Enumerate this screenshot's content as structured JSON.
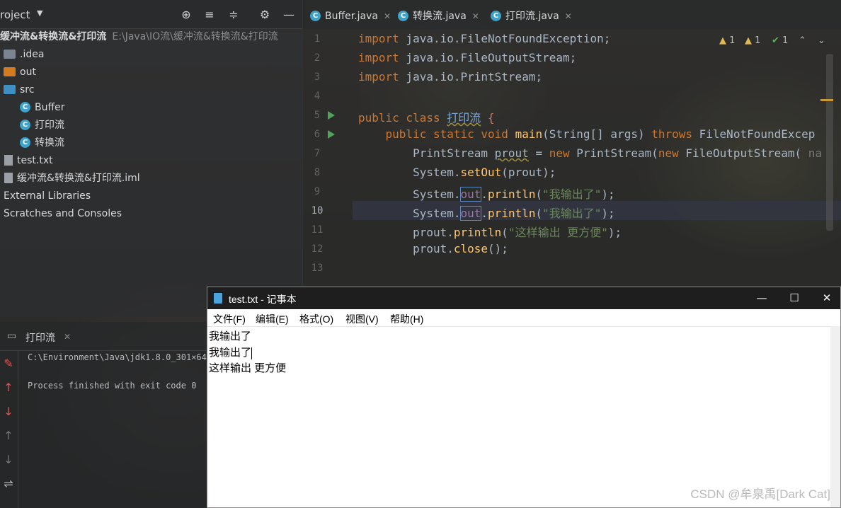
{
  "project_panel": {
    "title": "roject",
    "dropdown": "▼",
    "root": {
      "label": "缓冲流&转换流&打印流",
      "path": "E:\\Java\\IO流\\缓冲流&转换流&打印流"
    },
    "items": [
      {
        "label": ".idea",
        "kind": "folder"
      },
      {
        "label": "out",
        "kind": "folder"
      },
      {
        "label": "src",
        "kind": "folder"
      },
      {
        "label": "Buffer",
        "kind": "class"
      },
      {
        "label": "打印流",
        "kind": "class"
      },
      {
        "label": "转换流",
        "kind": "class"
      },
      {
        "label": "test.txt",
        "kind": "file"
      },
      {
        "label": "缓冲流&转换流&打印流.iml",
        "kind": "file"
      },
      {
        "label": "External Libraries",
        "kind": "node"
      },
      {
        "label": "Scratches and Consoles",
        "kind": "node"
      }
    ],
    "colors": {
      "idea_folder": "#7a8591",
      "out_folder": "#d47a1f",
      "src_folder": "#3d8fc4",
      "class_icon": "#3da3c9"
    }
  },
  "tabs": [
    {
      "label": "Buffer.java",
      "close": "✕"
    },
    {
      "label": "转换流.java",
      "close": "✕"
    },
    {
      "label": "打印流.java",
      "close": "✕"
    }
  ],
  "editor": {
    "line_numbers": [
      "1",
      "2",
      "3",
      "4",
      "5",
      "6",
      "7",
      "8",
      "9",
      "10",
      "11",
      "12",
      "13"
    ],
    "current_line": "10",
    "inspections": {
      "warn1": "1",
      "warn2": "1",
      "ok": "1"
    },
    "code": {
      "l1_kw": "import",
      "l1_rest": " java.io.FileNotFoundException;",
      "l2_kw": "import",
      "l2_rest": " java.io.FileOutputStream;",
      "l3_kw": "import",
      "l3_rest": " java.io.PrintStream;",
      "l5_kw": "public class",
      "l5_name": "打印流",
      "l5_brace": " {",
      "l6_kw1": "public static void",
      "l6_fn": "main",
      "l6_mid": "(String[] args) ",
      "l6_kw2": "throws",
      "l6_rest": " FileNotFoundExcep",
      "l7_a": "PrintStream ",
      "l7_var": "prout",
      "l7_b": " = ",
      "l7_kw": "new",
      "l7_c": " PrintStream(",
      "l7_kw2": "new",
      "l7_d": " FileOutputStream(",
      "l7_hint": " na",
      "l8_a": "System.",
      "l8_fn": "setOut",
      "l8_b": "(prout);",
      "l9_a": "System.",
      "l9_fld": "out",
      "l9_b": ".",
      "l9_fn": "println",
      "l9_c": "(",
      "l9_str": "\"我输出了\"",
      "l9_d": ");",
      "l10_a": "System.",
      "l10_fld": "out",
      "l10_b": ".",
      "l10_fn": "println",
      "l10_c": "(",
      "l10_str": "\"我输出了\"",
      "l10_d": ");",
      "l11_a": "prout.",
      "l11_fn": "println",
      "l11_b": "(",
      "l11_str": "\"这样输出 更方便\"",
      "l11_c": ");",
      "l12_a": "prout.",
      "l12_fn": "close",
      "l12_b": "();"
    }
  },
  "run_panel": {
    "tab_label": "打印流",
    "close": "✕",
    "console_lines": [
      "C:\\Environment\\Java\\jdk1.8.0_301×64\\",
      "Process finished with exit code 0"
    ]
  },
  "notepad": {
    "title": "test.txt - 记事本",
    "window_buttons": {
      "min": "—",
      "max": "☐",
      "close": "✕"
    },
    "menu": [
      "文件(F)",
      "编辑(E)",
      "格式(O)",
      "视图(V)",
      "帮助(H)"
    ],
    "lines": [
      "我输出了",
      "我输出了",
      "这样输出 更方便"
    ]
  },
  "watermark": "CSDN @牟泉禹[Dark Cat]"
}
